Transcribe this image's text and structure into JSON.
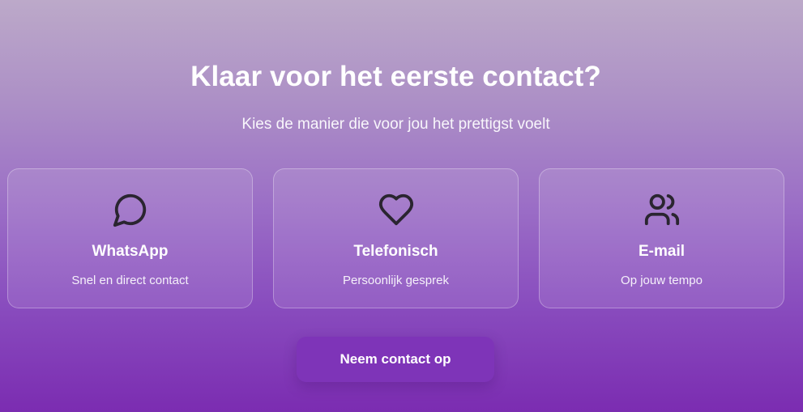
{
  "cta_section": {
    "title": "Klaar voor het eerste contact?",
    "subtitle": "Kies de manier die voor jou het prettigst voelt",
    "options": [
      {
        "icon": "chat-bubble-icon",
        "title": "WhatsApp",
        "description": "Snel en direct contact"
      },
      {
        "icon": "heart-icon",
        "title": "Telefonisch",
        "description": "Persoonlijk gesprek"
      },
      {
        "icon": "users-icon",
        "title": "E-mail",
        "description": "Op jouw tempo"
      }
    ],
    "button_label": "Neem contact op"
  },
  "colors": {
    "gradient_top": "#bca9c9",
    "gradient_bottom": "#7b2cb1",
    "button_bg": "#7e34b8",
    "icon_stroke": "#2a2530",
    "text": "#ffffff"
  }
}
